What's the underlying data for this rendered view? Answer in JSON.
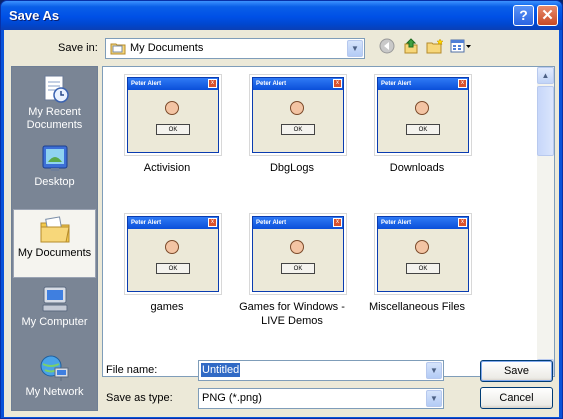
{
  "window": {
    "title": "Save As",
    "help_label": "?",
    "close_label": "✕"
  },
  "toolbar": {
    "save_in_label": "Save in:",
    "save_in_value": "My Documents",
    "icons": [
      "back-icon",
      "up-folder-icon",
      "new-folder-icon",
      "views-menu-icon"
    ]
  },
  "places": [
    {
      "label": "My Recent Documents",
      "icon": "recent-documents-icon"
    },
    {
      "label": "Desktop",
      "icon": "desktop-icon"
    },
    {
      "label": "My Documents",
      "icon": "my-documents-icon",
      "selected": true
    },
    {
      "label": "My Computer",
      "icon": "my-computer-icon"
    },
    {
      "label": "My Network",
      "icon": "my-network-icon"
    }
  ],
  "thumbnail": {
    "title": "Peter Alert",
    "button": "OK"
  },
  "files": [
    {
      "name": "Activision"
    },
    {
      "name": "DbgLogs"
    },
    {
      "name": "Downloads"
    },
    {
      "name": "games"
    },
    {
      "name": "Games for Windows - LIVE Demos"
    },
    {
      "name": "Miscellaneous Files"
    }
  ],
  "footer": {
    "file_name_label": "File name:",
    "file_name_value": "Untitled",
    "save_as_type_label": "Save as type:",
    "save_as_type_value": "PNG (*.png)",
    "save_button": "Save",
    "cancel_button": "Cancel"
  },
  "colors": {
    "title_bar": "#0050e6",
    "dialog_bg": "#ece9d8",
    "places_bar": "#7a8595",
    "selection": "#316ac5"
  }
}
